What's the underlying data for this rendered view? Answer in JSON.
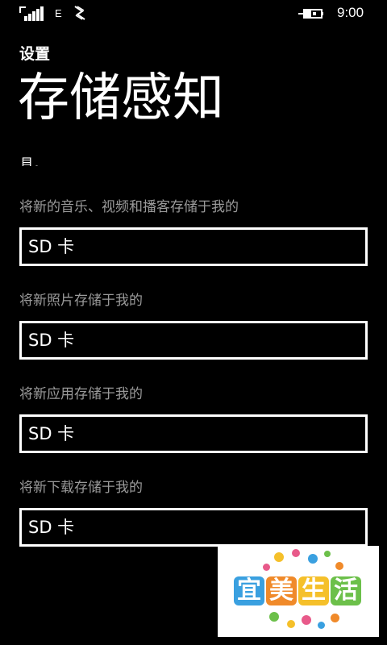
{
  "status_bar": {
    "network_type": "E",
    "time": "9:00",
    "icons": [
      "signal-strength-icon",
      "nfc-icon",
      "battery-charging-icon"
    ]
  },
  "header": {
    "app_title": "设置",
    "page_title": "存储感知"
  },
  "clipped_text": "具。",
  "settings": [
    {
      "label": "将新的音乐、视频和播客存储于我的",
      "value": "SD 卡"
    },
    {
      "label": "将新照片存储于我的",
      "value": "SD 卡"
    },
    {
      "label": "将新应用存储于我的",
      "value": "SD 卡"
    },
    {
      "label": "将新下载存储于我的",
      "value": "SD 卡"
    }
  ],
  "watermark": {
    "text": [
      "宜",
      "美",
      "生",
      "活"
    ],
    "colors": [
      "#3aa0e0",
      "#f08a2a",
      "#f5c02a",
      "#6cc04a"
    ]
  }
}
